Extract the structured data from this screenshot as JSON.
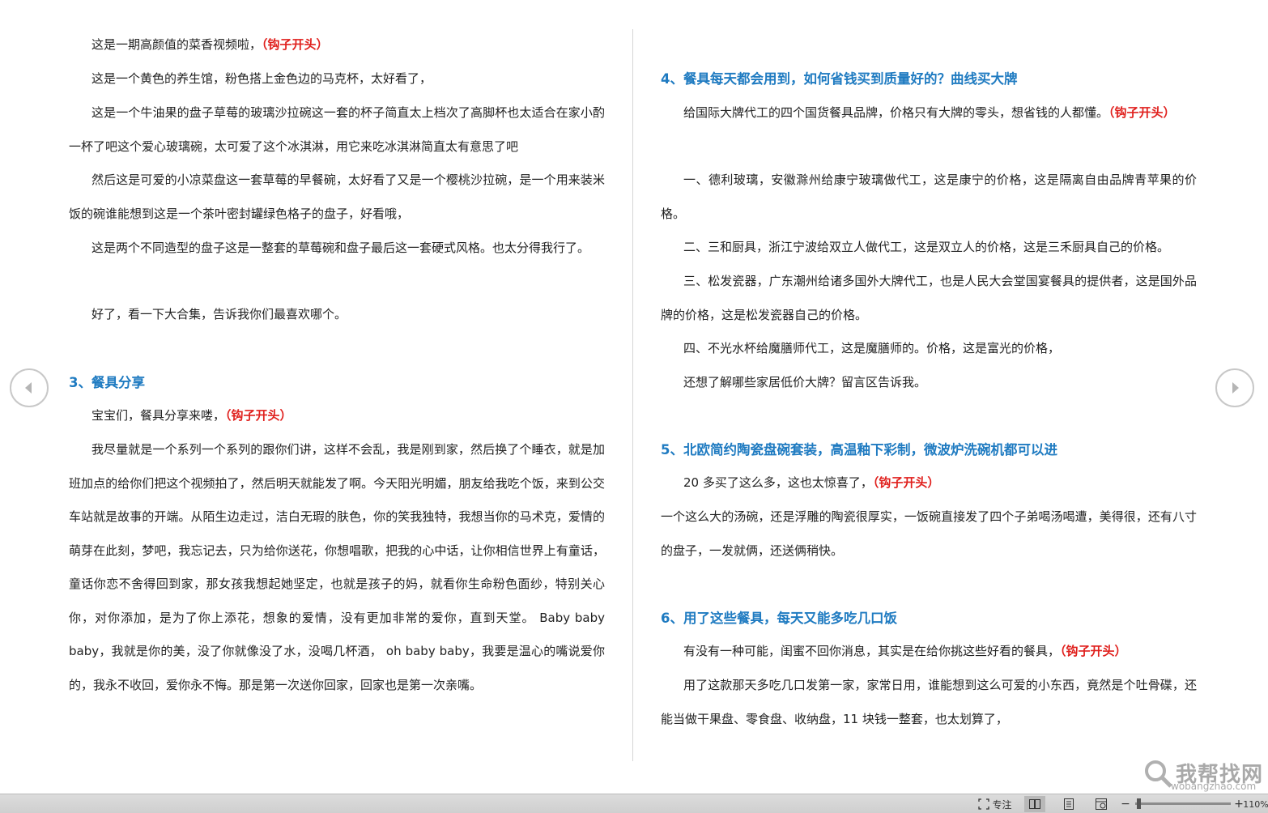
{
  "document": {
    "left_column": {
      "p1": "这是一期高颜值的菜香视频啦，",
      "p1_hook": "（钩子开头）",
      "p2": "这是一个黄色的养生馆，粉色搭上金色边的马克杯，太好看了，",
      "p3": "这是一个牛油果的盘子草莓的玻璃沙拉碗这一套的杯子简直太上档次了高脚杯也太适合在家小酌一杯了吧这个爱心玻璃碗，太可爱了这个冰淇淋，用它来吃冰淇淋简直太有意思了吧",
      "p4": "然后这是可爱的小凉菜盘这一套草莓的早餐碗，太好看了又是一个樱桃沙拉碗，是一个用来装米饭的碗谁能想到这是一个茶叶密封罐绿色格子的盘子，好看哦，",
      "p5": "这是两个不同造型的盘子这是一整套的草莓碗和盘子最后这一套硬式风格。也太分得我行了。",
      "p6": "好了，看一下大合集，告诉我你们最喜欢哪个。",
      "heading3": "3、餐具分享",
      "p7": "宝宝们，餐具分享来喽，",
      "p7_hook": "（钩子开头）",
      "p8": "我尽量就是一个系列一个系列的跟你们讲，这样不会乱，我是刚到家，然后换了个睡衣，就是加班加点的给你们把这个视频拍了，然后明天就能发了啊。今天阳光明媚，朋友给我吃个饭，来到公交车站就是故事的开端。从陌生边走过，洁白无瑕的肤色，你的笑我独特，我想当你的马术克，爱情的萌芽在此刻，梦吧，我忘记去，只为给你送花，你想唱歌，把我的心中话，让你相信世界上有童话，童话你恋不舍得回到家，那女孩我想起她坚定，也就是孩子的妈，就看你生命粉色面纱，特别关心你，对你添加，是为了你上添花，想象的爱情，没有更加非常的爱你，直到天堂。 Baby baby baby，我就是你的美，没了你就像没了水，没喝几杯酒，  oh baby baby，我要是温心的嘴说爱你的，我永不收回，爱你永不悔。那是第一次送你回家，回家也是第一次亲嘴。"
    },
    "right_column": {
      "heading4": "4、餐具每天都会用到，如何省钱买到质量好的？曲线买大牌",
      "p1": "给国际大牌代工的四个国货餐具品牌，价格只有大牌的零头，想省钱的人都懂。",
      "p1_hook": "（钩子开头）",
      "p2": "一、德利玻璃，安徽滁州给康宁玻璃做代工，这是康宁的价格，这是隔离自由品牌青苹果的价格。",
      "p3": "二、三和厨具，浙江宁波给双立人做代工，这是双立人的价格，这是三禾厨具自己的价格。",
      "p4": "三、松发瓷器，广东潮州给诸多国外大牌代工，也是人民大会堂国宴餐具的提供者，这是国外品牌的价格，这是松发瓷器自己的价格。",
      "p5": "四、不光水杯给魔膳师代工，这是魔膳师的。价格，这是富光的价格，",
      "p6": "还想了解哪些家居低价大牌？留言区告诉我。",
      "heading5": "5、北欧简约陶瓷盘碗套装，高温釉下彩制，微波炉洗碗机都可以进",
      "p7": "20 多买了这么多，这也太惊喜了，",
      "p7_hook": "（钩子开头）",
      "p8": "一个这么大的汤碗，还是浮雕的陶瓷很厚实，一饭碗直接发了四个子弟喝汤喝遭，美得很，还有八寸的盘子，一发就俩，还送俩稍快。",
      "heading6": "6、用了这些餐具，每天又能多吃几口饭",
      "p9": "有没有一种可能，闺蜜不回你消息，其实是在给你挑这些好看的餐具，",
      "p9_hook": "（钩子开头）",
      "p10": "用了这款那天多吃几口发第一家，家常日用，谁能想到这么可爱的小东西，竟然是个吐骨碟，还能当做干果盘、零食盘、收纳盘，11 块钱一整套，也太划算了，"
    }
  },
  "status_bar": {
    "focus_label": "专注",
    "zoom_out": "−",
    "zoom_in": "+",
    "zoom_level": "110%"
  },
  "watermark": {
    "text": "我帮找网",
    "url": "wobangzhao.com"
  },
  "icons": {
    "prev": "chevron-left-icon",
    "next": "chevron-right-icon",
    "focus": "focus-icon",
    "read_mode": "read-mode-icon",
    "print_layout": "print-layout-icon",
    "web_layout": "web-layout-icon",
    "watermark_logo": "magnifier-icon"
  },
  "colors": {
    "heading": "#1f7bc1",
    "hook": "#e0201d",
    "body_text": "#222222"
  }
}
